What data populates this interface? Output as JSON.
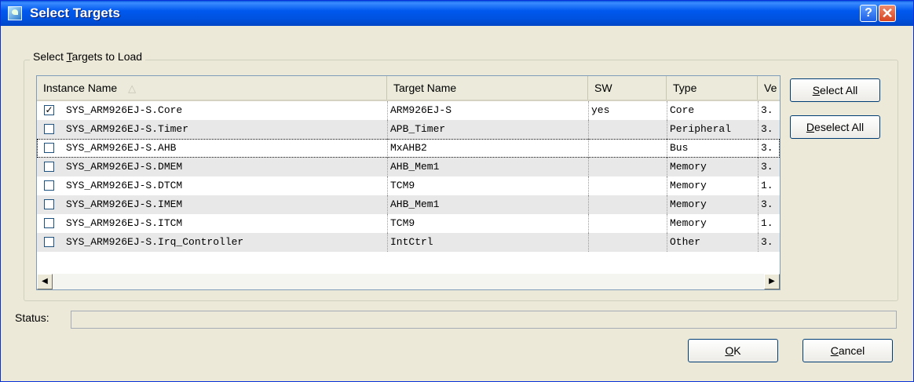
{
  "window": {
    "title": "Select Targets",
    "help_label": "?",
    "close_label": "✕"
  },
  "group": {
    "label_pre": "Select ",
    "label_accel": "T",
    "label_post": "argets to Load"
  },
  "table": {
    "columns": [
      "Instance Name",
      "Target Name",
      "SW",
      "Type",
      "Ve"
    ],
    "sort_icon": "△",
    "rows": [
      {
        "checked": true,
        "instance": "SYS_ARM926EJ-S.Core",
        "target": "ARM926EJ-S",
        "sw": "yes",
        "type": "Core",
        "ver": "3."
      },
      {
        "checked": false,
        "instance": "SYS_ARM926EJ-S.Timer",
        "target": "APB_Timer",
        "sw": "",
        "type": "Peripheral",
        "ver": "3."
      },
      {
        "checked": false,
        "instance": "SYS_ARM926EJ-S.AHB",
        "target": "MxAHB2",
        "sw": "",
        "type": "Bus",
        "ver": "3."
      },
      {
        "checked": false,
        "instance": "SYS_ARM926EJ-S.DMEM",
        "target": "AHB_Mem1",
        "sw": "",
        "type": "Memory",
        "ver": "3."
      },
      {
        "checked": false,
        "instance": "SYS_ARM926EJ-S.DTCM",
        "target": "TCM9",
        "sw": "",
        "type": "Memory",
        "ver": "1."
      },
      {
        "checked": false,
        "instance": "SYS_ARM926EJ-S.IMEM",
        "target": "AHB_Mem1",
        "sw": "",
        "type": "Memory",
        "ver": "3."
      },
      {
        "checked": false,
        "instance": "SYS_ARM926EJ-S.ITCM",
        "target": "TCM9",
        "sw": "",
        "type": "Memory",
        "ver": "1."
      },
      {
        "checked": false,
        "instance": "SYS_ARM926EJ-S.Irq_Controller",
        "target": "IntCtrl",
        "sw": "",
        "type": "Other",
        "ver": "3."
      }
    ]
  },
  "buttons": {
    "select_all": {
      "accel": "S",
      "rest": "elect All"
    },
    "deselect_all": {
      "accel": "D",
      "rest": "eselect All"
    },
    "ok": {
      "accel": "O",
      "rest": "K"
    },
    "cancel": {
      "accel": "C",
      "rest": "ancel"
    }
  },
  "status": {
    "label": "Status:",
    "value": ""
  },
  "scrollbar": {
    "left_arrow": "◀",
    "right_arrow": "▶"
  },
  "colors": {
    "titlebar": "#0058ee",
    "dialog_bg": "#ece9d8",
    "alt_row": "#e8e8e8"
  }
}
